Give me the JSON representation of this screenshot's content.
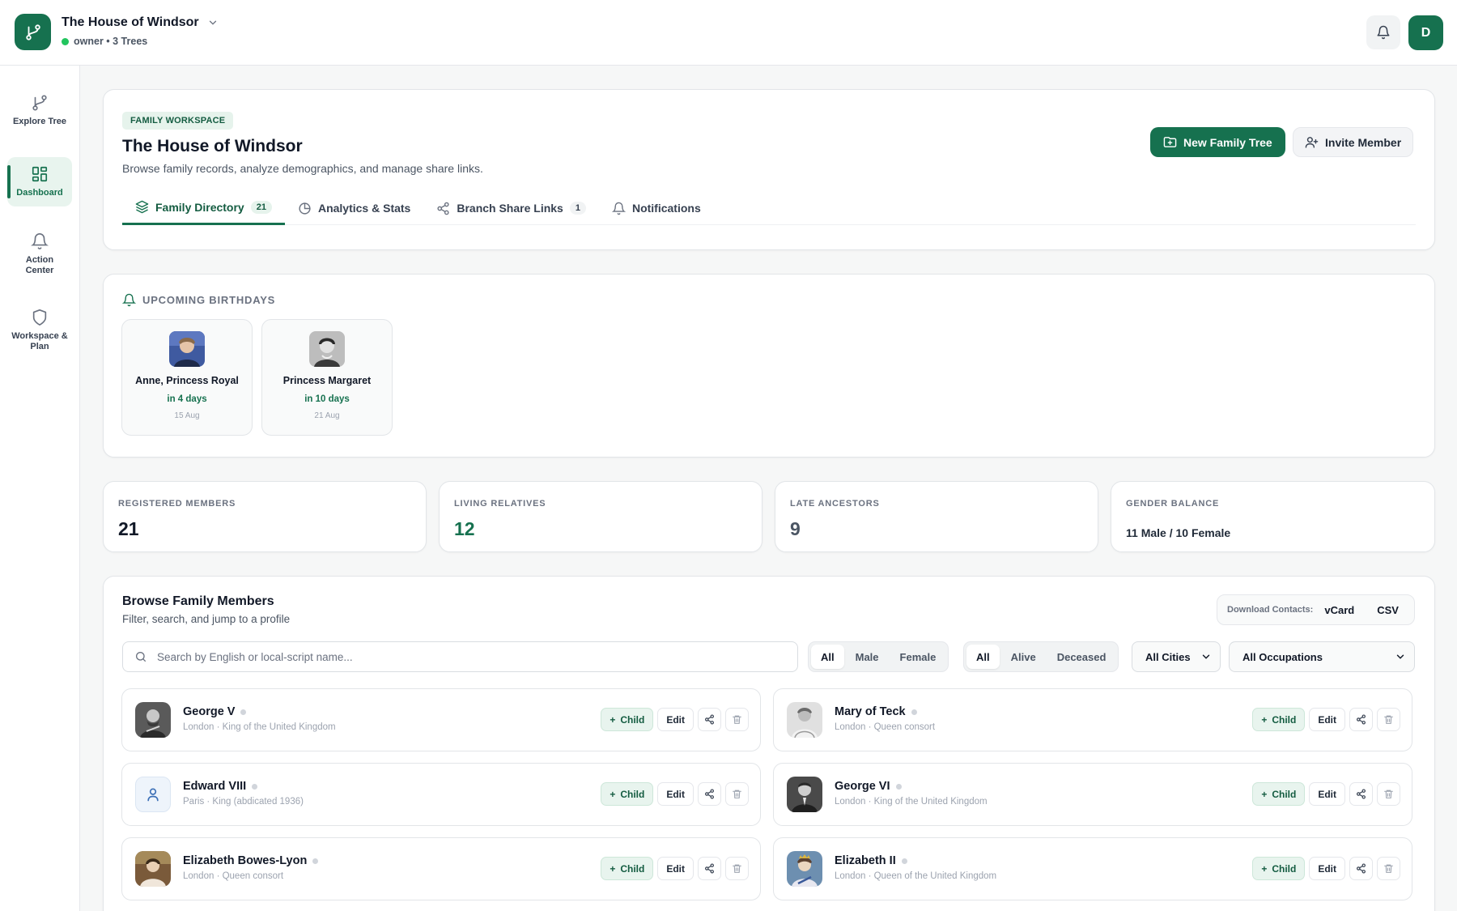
{
  "workspace": {
    "name": "The House of Windsor",
    "role_line": "owner • 3 Trees"
  },
  "user": {
    "initial": "D"
  },
  "sidebar": {
    "items": [
      {
        "label": "Explore Tree"
      },
      {
        "label": "Dashboard"
      },
      {
        "label": "Action Center"
      },
      {
        "label": "Workspace & Plan"
      }
    ]
  },
  "header": {
    "badge": "FAMILY WORKSPACE",
    "title": "The House of Windsor",
    "description": "Browse family records, analyze demographics, and manage share links.",
    "new_tree_label": "New Family Tree",
    "invite_label": "Invite Member",
    "tabs": [
      {
        "label": "Family Directory",
        "count": "21"
      },
      {
        "label": "Analytics & Stats"
      },
      {
        "label": "Branch Share Links",
        "count": "1"
      },
      {
        "label": "Notifications"
      }
    ]
  },
  "birthdays": {
    "label": "UPCOMING BIRTHDAYS",
    "items": [
      {
        "name": "Anne, Princess Royal",
        "when": "in 4 days",
        "date": "15 Aug"
      },
      {
        "name": "Princess Margaret",
        "when": "in 10 days",
        "date": "21 Aug"
      }
    ]
  },
  "stats": [
    {
      "label": "REGISTERED MEMBERS",
      "value": "21"
    },
    {
      "label": "LIVING RELATIVES",
      "value": "12"
    },
    {
      "label": "LATE ANCESTORS",
      "value": "9"
    },
    {
      "label": "GENDER BALANCE",
      "value": "11 Male / 10 Female"
    }
  ],
  "browse": {
    "title": "Browse Family Members",
    "subtitle": "Filter, search, and jump to a profile",
    "download_label": "Download Contacts:",
    "vcard": "vCard",
    "csv": "CSV",
    "search_placeholder": "Search by English or local-script name...",
    "gender_filter": [
      "All",
      "Male",
      "Female"
    ],
    "status_filter": [
      "All",
      "Alive",
      "Deceased"
    ],
    "city_select": "All Cities",
    "occupation_select": "All Occupations",
    "child_label": "Child",
    "edit_label": "Edit"
  },
  "members": [
    {
      "name": "George V",
      "meta": "London · King of the United Kingdom"
    },
    {
      "name": "Mary of Teck",
      "meta": "London · Queen consort"
    },
    {
      "name": "Edward VIII",
      "meta": "Paris · King (abdicated 1936)"
    },
    {
      "name": "George VI",
      "meta": "London · King of the United Kingdom"
    },
    {
      "name": "Elizabeth Bowes-Lyon",
      "meta": "London · Queen consort"
    },
    {
      "name": "Elizabeth II",
      "meta": "London · Queen of the United Kingdom"
    }
  ],
  "colors": {
    "brand": "#16714f",
    "brand_light": "#e8f4ee",
    "border": "#e2e5e8"
  }
}
